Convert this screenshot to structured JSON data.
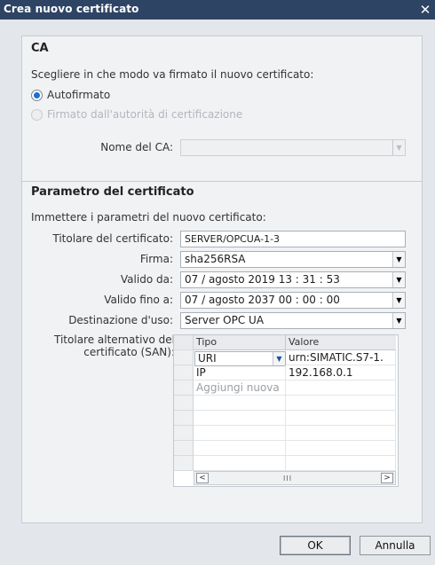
{
  "window": {
    "title": "Crea nuovo certificato",
    "close_glyph": "✕"
  },
  "ca": {
    "heading": "CA",
    "prompt": "Scegliere in che modo va firmato il nuovo certificato:",
    "opt_self": "Autofirmato",
    "opt_authority": "Firmato dall'autorità di certificazione",
    "ca_name_label": "Nome del CA:",
    "ca_name_value": ""
  },
  "params": {
    "heading": "Parametro del certificato",
    "prompt": "Immettere i parametri del nuovo certificato:",
    "holder_label": "Titolare del certificato:",
    "holder_value": "SERVER/OPCUA-1-3",
    "signature_label": "Firma:",
    "signature_value": "sha256RSA",
    "valid_from_label": "Valido da:",
    "valid_from_value": "07 / agosto  2019  13 : 31 : 53",
    "valid_to_label": "Valido fino a:",
    "valid_to_value": "07 / agosto  2037  00 : 00 : 00",
    "usage_label": "Destinazione d'uso:",
    "usage_value": "Server OPC UA",
    "san_label_1": "Titolare alternativo del",
    "san_label_2": "certificato (SAN):"
  },
  "san_table": {
    "col_type": "Tipo",
    "col_value": "Valore",
    "rows": [
      {
        "type": "URI",
        "value": "urn:SIMATIC.S7-1."
      },
      {
        "type": "IP",
        "value": "192.168.0.1"
      }
    ],
    "add_new": "Aggiungi nuova",
    "scroll_left": "<",
    "scroll_right": ">",
    "scroll_thumb": "III"
  },
  "buttons": {
    "ok": "OK",
    "cancel": "Annulla"
  },
  "icons": {
    "dropdown": "▼",
    "close": "close-icon"
  },
  "colors": {
    "titlebar": "#2e4464",
    "radio_selected": "#1c6ed8",
    "dialog_bg": "#e3e6ea"
  }
}
